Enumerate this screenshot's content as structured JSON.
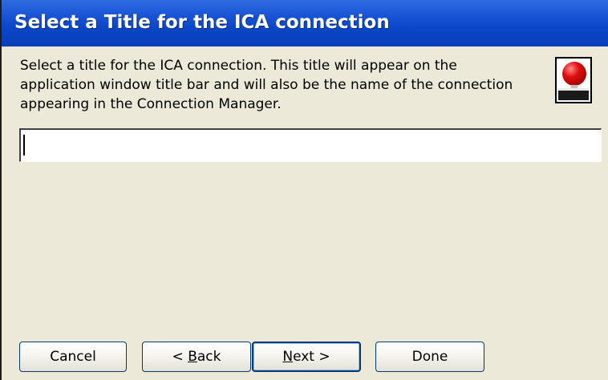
{
  "dialog": {
    "title": "Select a Title for the ICA connection",
    "description": "Select a title for the ICA connection. This title will appear on the application window title bar and will also be the name of the connection appearing in the Connection Manager.",
    "icon": "connection-app-icon"
  },
  "title_input": {
    "value": "",
    "placeholder": ""
  },
  "buttons": {
    "cancel": "Cancel",
    "back_prefix": "< ",
    "back_mnemonic": "B",
    "back_rest": "ack",
    "next_mnemonic": "N",
    "next_rest": "ext >",
    "done": "Done"
  },
  "colors": {
    "titlebar": "#0a46c8",
    "background": "#ece9d8",
    "button_border": "#003c74"
  }
}
